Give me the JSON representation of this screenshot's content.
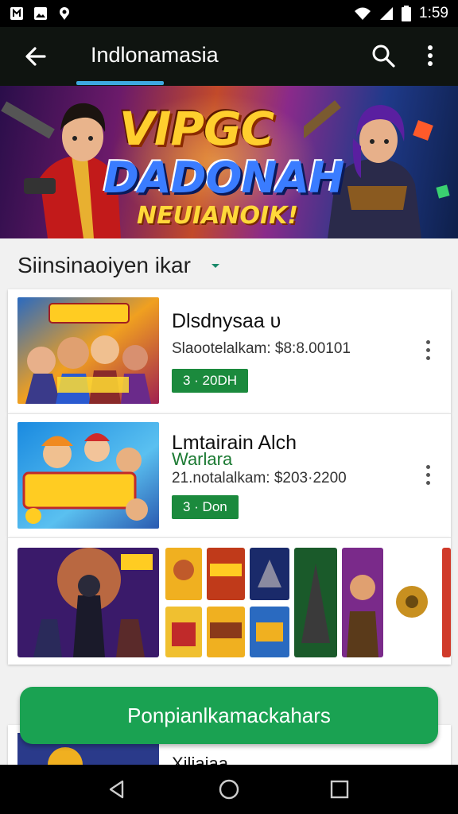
{
  "status_bar": {
    "time": "1:59",
    "left_icons": [
      "notification-icon",
      "image-icon",
      "location-icon"
    ],
    "right_icons": [
      "wifi-icon",
      "signal-icon",
      "battery-icon"
    ]
  },
  "app_bar": {
    "title": "Indlonamasia",
    "back_icon": "arrow-back-icon",
    "search_icon": "search-icon",
    "more_icon": "more-vert-icon",
    "accent_color": "#3da9e0"
  },
  "banner": {
    "line1": "VIPGC",
    "line2": "DADONAH",
    "line3": "NEUIANOIK!"
  },
  "section": {
    "title": "Siinsinaoiyen ikar",
    "caret_icon": "dropdown-caret-icon"
  },
  "items": [
    {
      "title": "Dlsdnysaa υ",
      "subtitle": "",
      "meta": "Slaootelalkam: $8:8.00101",
      "badge": "3 · 20DH",
      "thumb_text": "Horderis"
    },
    {
      "title": "Lmtairain Alch",
      "subtitle": "Warlara",
      "meta": "21.notalalkam: $203·2200",
      "badge": "3 · Don",
      "thumb_text": "MUIISTAN CUURSS"
    }
  ],
  "gallery_count": 7,
  "cta": {
    "label": "Ponpianlkamackahars",
    "color": "#1aa252"
  },
  "peek_card": {
    "title": "Xiliaiaa"
  },
  "nav_bar": {
    "icons": [
      "back-triangle-icon",
      "home-circle-icon",
      "recents-square-icon"
    ]
  },
  "colors": {
    "badge_green": "#1b8a3d",
    "background": "#f1f1f1"
  }
}
